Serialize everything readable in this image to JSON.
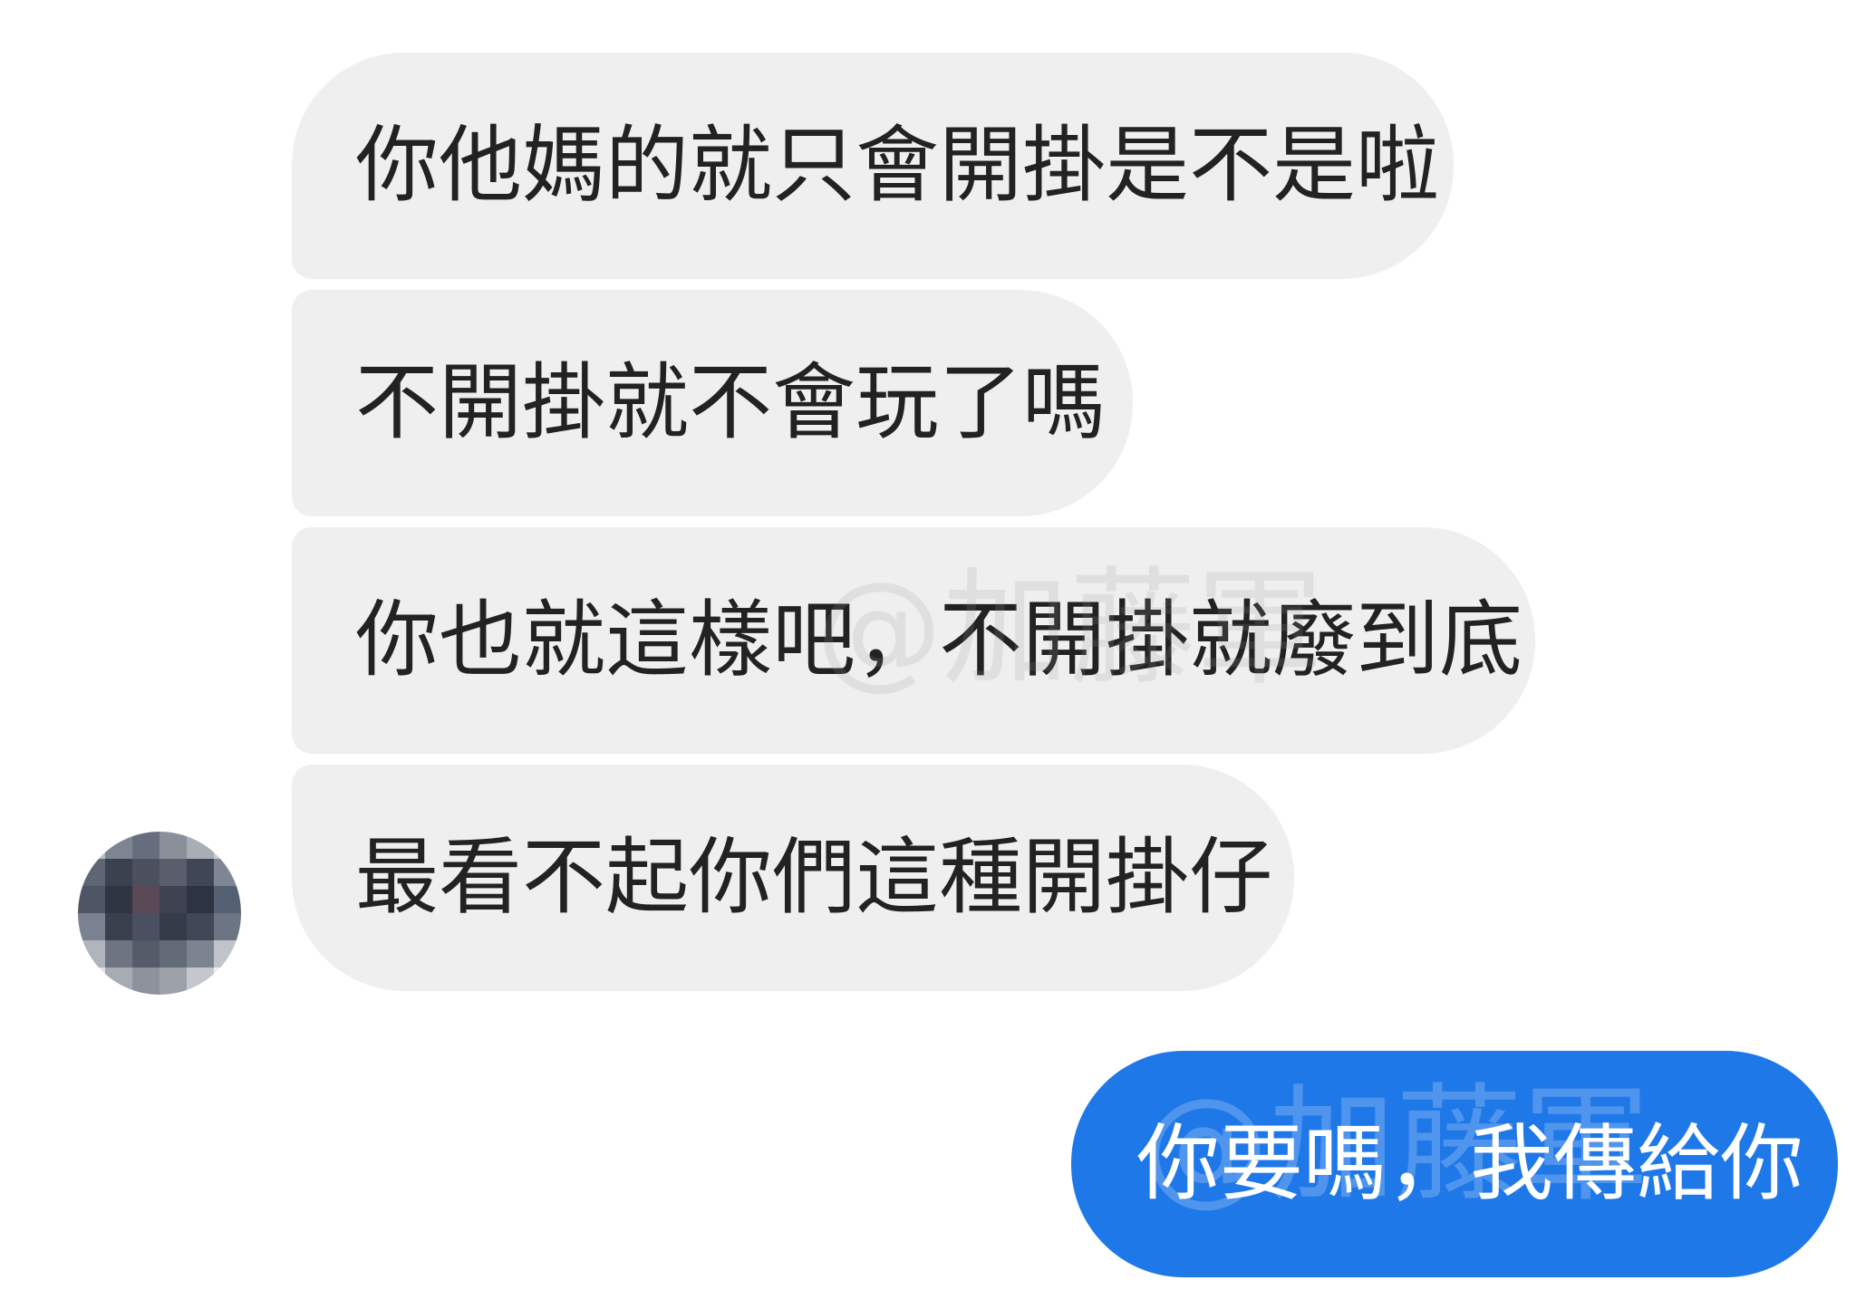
{
  "messages": {
    "incoming": [
      {
        "text": "你他媽的就只會開掛是不是啦"
      },
      {
        "text": "不開掛就不會玩了嗎"
      },
      {
        "text": "你也就這樣吧，不開掛就廢到底"
      },
      {
        "text": "最看不起你們這種開掛仔"
      }
    ],
    "outgoing": [
      {
        "text": "你要嗎，我傳給你"
      }
    ]
  },
  "watermark": "@加藤軍",
  "colors": {
    "incoming_bubble": "#efefef",
    "outgoing_bubble": "#1f78e8",
    "incoming_text": "#222222",
    "outgoing_text": "#ffffff"
  },
  "avatar_pixels": [
    "#b8bcc4",
    "#7d8592",
    "#666e7d",
    "#8a8f99",
    "#a9adb5",
    "#c9ccd2",
    "#5e6675",
    "#3a414f",
    "#4b4f5e",
    "#5a5d6b",
    "#3f4656",
    "#7e8593",
    "#4e5565",
    "#2f3542",
    "#5a4a57",
    "#3d4150",
    "#2c3444",
    "#556073",
    "#7a8190",
    "#3a3f4d",
    "#4a5060",
    "#353b48",
    "#404857",
    "#6d7584",
    "#b0b4bc",
    "#6e7482",
    "#555b69",
    "#636a78",
    "#7c8391",
    "#c0c3ca",
    "#e2e4e8",
    "#a7abb3",
    "#8d929c",
    "#9da1aa",
    "#c4c7cd",
    "#eceef1"
  ]
}
